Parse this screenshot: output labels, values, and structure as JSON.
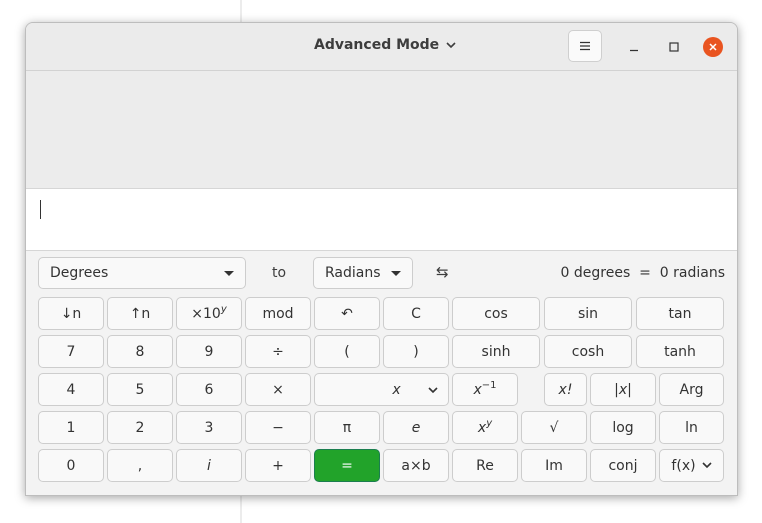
{
  "window": {
    "title": "Advanced Mode",
    "menu_icon": "hamburger-icon",
    "controls": [
      "minimize-icon",
      "maximize-icon",
      "close-icon"
    ]
  },
  "history": [],
  "entry": {
    "value": ""
  },
  "conversion": {
    "from_unit": "Degrees",
    "to_label": "to",
    "to_unit": "Radians",
    "swap_icon": "⇆",
    "result": "0 degrees  =  0 radians"
  },
  "keypad": {
    "r1": [
      "↓n",
      "↑n",
      "×10",
      "y",
      "mod",
      "↶",
      "C",
      "cos",
      "sin",
      "tan"
    ],
    "r2": [
      "7",
      "8",
      "9",
      "÷",
      "(",
      ")",
      "sinh",
      "cosh",
      "tanh"
    ],
    "r3": [
      "4",
      "5",
      "6",
      "×",
      "x",
      "x",
      "−1",
      "x!",
      "|x|",
      "Arg"
    ],
    "r4": [
      "1",
      "2",
      "3",
      "−",
      "π",
      "e",
      "x",
      "y",
      "√",
      "log",
      "ln"
    ],
    "r5": [
      "0",
      ",",
      "i",
      "+",
      "=",
      "a×b",
      "Re",
      "Im",
      "conj",
      "f(x)"
    ]
  },
  "colors": {
    "accent": "#22a32a",
    "close": "#e95420"
  }
}
